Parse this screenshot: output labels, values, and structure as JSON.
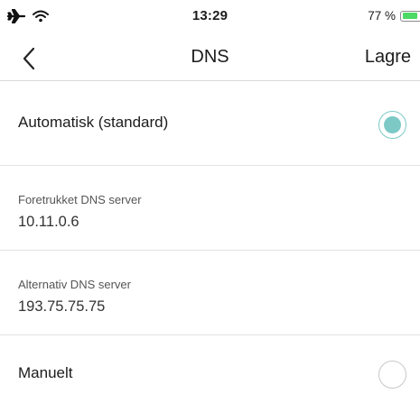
{
  "status_bar": {
    "time": "13:29",
    "battery_percent_text": "77 %",
    "battery_level": 0.77,
    "icons": [
      "airplane-icon",
      "wifi-icon",
      "battery-icon"
    ]
  },
  "nav": {
    "back_icon": "chevron-left-icon",
    "title": "DNS",
    "save_label": "Lagre"
  },
  "options": {
    "automatic": {
      "label": "Automatisk (standard)",
      "selected": true
    },
    "preferred_dns": {
      "label": "Foretrukket DNS server",
      "value": "10.11.0.6"
    },
    "alternate_dns": {
      "label": "Alternativ DNS server",
      "value": "193.75.75.75"
    },
    "manual": {
      "label": "Manuelt",
      "selected": false
    }
  },
  "colors": {
    "accent": "#7cc9c6",
    "battery_green": "#4cd964",
    "divider": "#e2e2e2"
  }
}
